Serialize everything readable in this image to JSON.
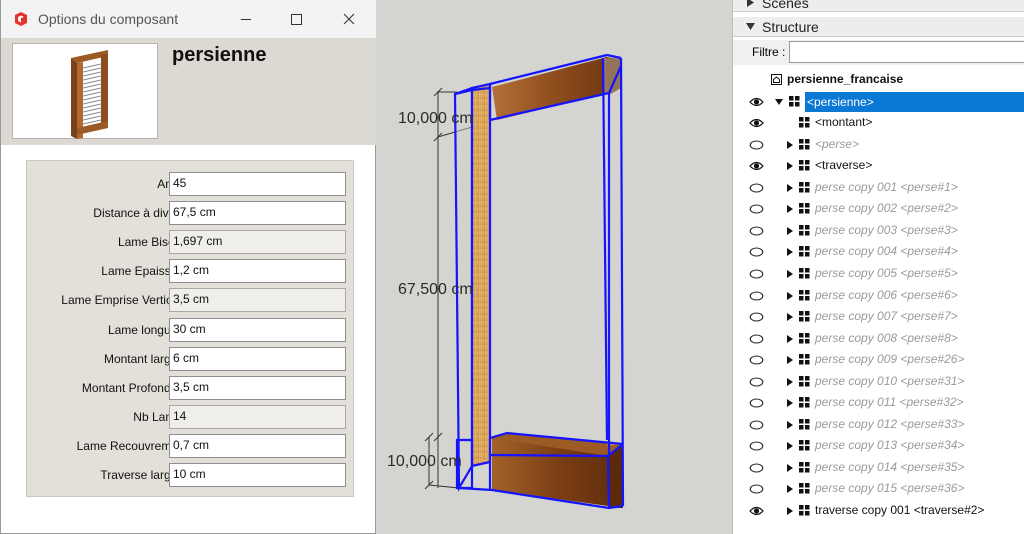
{
  "dialog": {
    "title": "Options du composant",
    "component_name": "persienne",
    "params": [
      {
        "label": "Angle",
        "value": "45",
        "readonly": false
      },
      {
        "label": "Distance à diviser",
        "value": "67,5 cm",
        "readonly": false
      },
      {
        "label": "Lame Biseau",
        "value": "1,697 cm",
        "readonly": true
      },
      {
        "label": "Lame Epaisseur",
        "value": "1,2 cm",
        "readonly": false
      },
      {
        "label": "Lame Emprise Verticale",
        "value": "3,5 cm",
        "readonly": true
      },
      {
        "label": "Lame longueur",
        "value": "30 cm",
        "readonly": false
      },
      {
        "label": "Montant largeur",
        "value": "6 cm",
        "readonly": false
      },
      {
        "label": "Montant Profondeur",
        "value": "3,5 cm",
        "readonly": false
      },
      {
        "label": "Nb Lames",
        "value": "14",
        "readonly": true
      },
      {
        "label": "Lame Recouvrement",
        "value": "0,7 cm",
        "readonly": false
      },
      {
        "label": "Traverse largeur",
        "value": "10 cm",
        "readonly": false
      }
    ]
  },
  "viewport": {
    "dim_top": "10,000 cm",
    "dim_mid": "67,500 cm",
    "dim_bottom": "10,000 cm"
  },
  "panel": {
    "scenes_label": "Scènes",
    "structure_label": "Structure",
    "filter_label": "Filtre :",
    "filter_value": "",
    "tree": [
      {
        "label": "persienne_francaise",
        "eye": "none",
        "expander": "none",
        "indent": 0,
        "icon": "model",
        "style": "root"
      },
      {
        "label": "<persienne>",
        "eye": "open",
        "expander": "down",
        "indent": 1,
        "icon": "component",
        "style": "selected"
      },
      {
        "label": "<montant>",
        "eye": "open",
        "expander": "none",
        "indent": 2,
        "icon": "component",
        "style": "normal"
      },
      {
        "label": "<perse>",
        "eye": "closed",
        "expander": "right",
        "indent": 2,
        "icon": "component",
        "style": "hidden"
      },
      {
        "label": "<traverse>",
        "eye": "open",
        "expander": "right",
        "indent": 2,
        "icon": "component",
        "style": "normal"
      },
      {
        "label": "perse copy 001 <perse#1>",
        "eye": "closed",
        "expander": "right",
        "indent": 2,
        "icon": "component",
        "style": "hidden"
      },
      {
        "label": "perse copy 002 <perse#2>",
        "eye": "closed",
        "expander": "right",
        "indent": 2,
        "icon": "component",
        "style": "hidden"
      },
      {
        "label": "perse copy 003 <perse#3>",
        "eye": "closed",
        "expander": "right",
        "indent": 2,
        "icon": "component",
        "style": "hidden"
      },
      {
        "label": "perse copy 004 <perse#4>",
        "eye": "closed",
        "expander": "right",
        "indent": 2,
        "icon": "component",
        "style": "hidden"
      },
      {
        "label": "perse copy 005 <perse#5>",
        "eye": "closed",
        "expander": "right",
        "indent": 2,
        "icon": "component",
        "style": "hidden"
      },
      {
        "label": "perse copy 006 <perse#6>",
        "eye": "closed",
        "expander": "right",
        "indent": 2,
        "icon": "component",
        "style": "hidden"
      },
      {
        "label": "perse copy 007 <perse#7>",
        "eye": "closed",
        "expander": "right",
        "indent": 2,
        "icon": "component",
        "style": "hidden"
      },
      {
        "label": "perse copy 008 <perse#8>",
        "eye": "closed",
        "expander": "right",
        "indent": 2,
        "icon": "component",
        "style": "hidden"
      },
      {
        "label": "perse copy 009 <perse#26>",
        "eye": "closed",
        "expander": "right",
        "indent": 2,
        "icon": "component",
        "style": "hidden"
      },
      {
        "label": "perse copy 010 <perse#31>",
        "eye": "closed",
        "expander": "right",
        "indent": 2,
        "icon": "component",
        "style": "hidden"
      },
      {
        "label": "perse copy 011 <perse#32>",
        "eye": "closed",
        "expander": "right",
        "indent": 2,
        "icon": "component",
        "style": "hidden"
      },
      {
        "label": "perse copy 012 <perse#33>",
        "eye": "closed",
        "expander": "right",
        "indent": 2,
        "icon": "component",
        "style": "hidden"
      },
      {
        "label": "perse copy 013 <perse#34>",
        "eye": "closed",
        "expander": "right",
        "indent": 2,
        "icon": "component",
        "style": "hidden"
      },
      {
        "label": "perse copy 014 <perse#35>",
        "eye": "closed",
        "expander": "right",
        "indent": 2,
        "icon": "component",
        "style": "hidden"
      },
      {
        "label": "perse copy 015 <perse#36>",
        "eye": "closed",
        "expander": "right",
        "indent": 2,
        "icon": "component",
        "style": "hidden"
      },
      {
        "label": "traverse copy 001 <traverse#2>",
        "eye": "open",
        "expander": "right",
        "indent": 2,
        "icon": "component",
        "style": "normal"
      }
    ]
  },
  "colors": {
    "selection": "#0b78d6",
    "edge_blue": "#1414ff",
    "wood": "#8a4a1c",
    "board": "#e2b56e"
  }
}
